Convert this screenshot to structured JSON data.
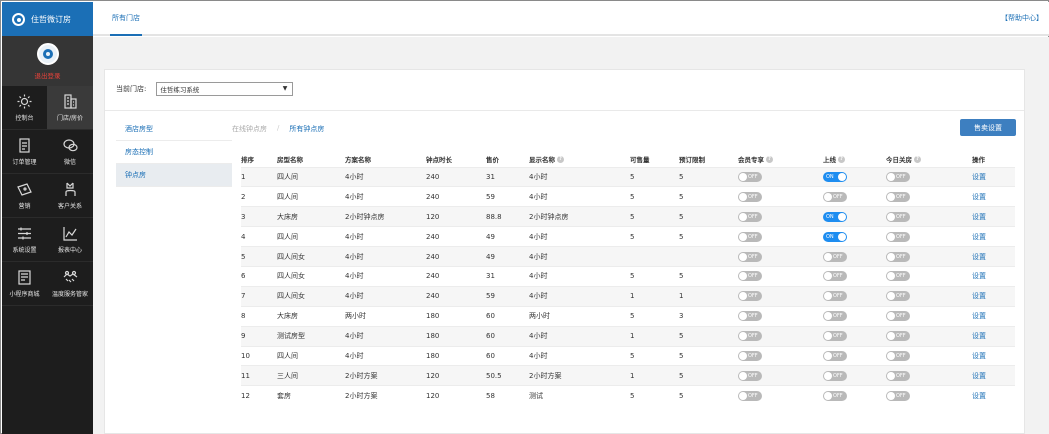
{
  "brand": {
    "name": "住哲微订房"
  },
  "profile": {
    "logout": "退出登录"
  },
  "menu": [
    {
      "label": "控制台",
      "icon": "sun-icon",
      "active": false
    },
    {
      "label": "门店/房价",
      "icon": "building-icon",
      "active": true
    },
    {
      "label": "订单管理",
      "icon": "document-icon",
      "active": false
    },
    {
      "label": "微信",
      "icon": "chat-icon",
      "active": false
    },
    {
      "label": "营销",
      "icon": "ticket-icon",
      "active": false
    },
    {
      "label": "客户关系",
      "icon": "people-icon",
      "active": false
    },
    {
      "label": "系统设置",
      "icon": "sliders-icon",
      "active": false
    },
    {
      "label": "报表中心",
      "icon": "chart-icon",
      "active": false
    },
    {
      "label": "小程序商城",
      "icon": "store-icon",
      "active": false
    },
    {
      "label": "温度服务管家",
      "icon": "handshake-icon",
      "active": false
    }
  ],
  "topbar": {
    "tab": "所有门店",
    "help": "【帮助中心】"
  },
  "store": {
    "label": "当前门店:",
    "selected": "住哲练习系统"
  },
  "leftnav": [
    {
      "label": "酒店房型",
      "active": false
    },
    {
      "label": "房态控制",
      "active": false
    },
    {
      "label": "钟点房",
      "active": true
    }
  ],
  "subtabs": {
    "online": "在线钟点房",
    "sep": "/",
    "all": "所有钟点房"
  },
  "sell_button": "售卖设置",
  "table": {
    "headers": [
      "排序",
      "房型名称",
      "方案名称",
      "钟点时长",
      "售价",
      "显示名称",
      "可售量",
      "预订限制",
      "会员专享",
      "上线",
      "今日关房",
      "操作"
    ],
    "help_cols": [
      5,
      8,
      9,
      10
    ],
    "rows": [
      {
        "sort": "1",
        "room": "四人间",
        "plan": "4小时",
        "duration": "240",
        "price": "31",
        "display": "4小时",
        "avail": "5",
        "limit": "5",
        "member": "OFF",
        "online": "ON",
        "closed": "OFF",
        "action": "设置"
      },
      {
        "sort": "2",
        "room": "四人间",
        "plan": "4小时",
        "duration": "240",
        "price": "59",
        "display": "4小时",
        "avail": "5",
        "limit": "5",
        "member": "OFF",
        "online": "OFF",
        "closed": "OFF",
        "action": "设置"
      },
      {
        "sort": "3",
        "room": "大床房",
        "plan": "2小时钟点房",
        "duration": "120",
        "price": "88.8",
        "display": "2小时钟点房",
        "avail": "5",
        "limit": "5",
        "member": "OFF",
        "online": "ON",
        "closed": "OFF",
        "action": "设置"
      },
      {
        "sort": "4",
        "room": "四人间",
        "plan": "4小时",
        "duration": "240",
        "price": "49",
        "display": "4小时",
        "avail": "5",
        "limit": "5",
        "member": "OFF",
        "online": "ON",
        "closed": "OFF",
        "action": "设置"
      },
      {
        "sort": "5",
        "room": "四人间女",
        "plan": "4小时",
        "duration": "240",
        "price": "49",
        "display": "4小时",
        "avail": "",
        "limit": "",
        "member": "OFF",
        "online": "OFF",
        "closed": "OFF",
        "action": "设置"
      },
      {
        "sort": "6",
        "room": "四人间女",
        "plan": "4小时",
        "duration": "240",
        "price": "31",
        "display": "4小时",
        "avail": "5",
        "limit": "5",
        "member": "OFF",
        "online": "OFF",
        "closed": "OFF",
        "action": "设置"
      },
      {
        "sort": "7",
        "room": "四人间女",
        "plan": "4小时",
        "duration": "240",
        "price": "59",
        "display": "4小时",
        "avail": "1",
        "limit": "1",
        "member": "OFF",
        "online": "OFF",
        "closed": "OFF",
        "action": "设置"
      },
      {
        "sort": "8",
        "room": "大床房",
        "plan": "两小时",
        "duration": "180",
        "price": "60",
        "display": "两小时",
        "avail": "5",
        "limit": "3",
        "member": "OFF",
        "online": "OFF",
        "closed": "OFF",
        "action": "设置"
      },
      {
        "sort": "9",
        "room": "测试房型",
        "plan": "4小时",
        "duration": "180",
        "price": "60",
        "display": "4小时",
        "avail": "1",
        "limit": "5",
        "member": "OFF",
        "online": "OFF",
        "closed": "OFF",
        "action": "设置"
      },
      {
        "sort": "10",
        "room": "四人间",
        "plan": "4小时",
        "duration": "180",
        "price": "60",
        "display": "4小时",
        "avail": "5",
        "limit": "5",
        "member": "OFF",
        "online": "OFF",
        "closed": "OFF",
        "action": "设置"
      },
      {
        "sort": "11",
        "room": "三人间",
        "plan": "2小时方案",
        "duration": "120",
        "price": "50.5",
        "display": "2小时方案",
        "avail": "1",
        "limit": "5",
        "member": "OFF",
        "online": "OFF",
        "closed": "OFF",
        "action": "设置"
      },
      {
        "sort": "12",
        "room": "套房",
        "plan": "2小时方案",
        "duration": "120",
        "price": "58",
        "display": "测试",
        "avail": "5",
        "limit": "5",
        "member": "OFF",
        "online": "OFF",
        "closed": "OFF",
        "action": "设置"
      }
    ]
  },
  "colors": {
    "brand": "#1b6fb6",
    "toggle_on": "#1e8df0",
    "toggle_off": "#b9b9b9",
    "logout": "#e9423a"
  }
}
